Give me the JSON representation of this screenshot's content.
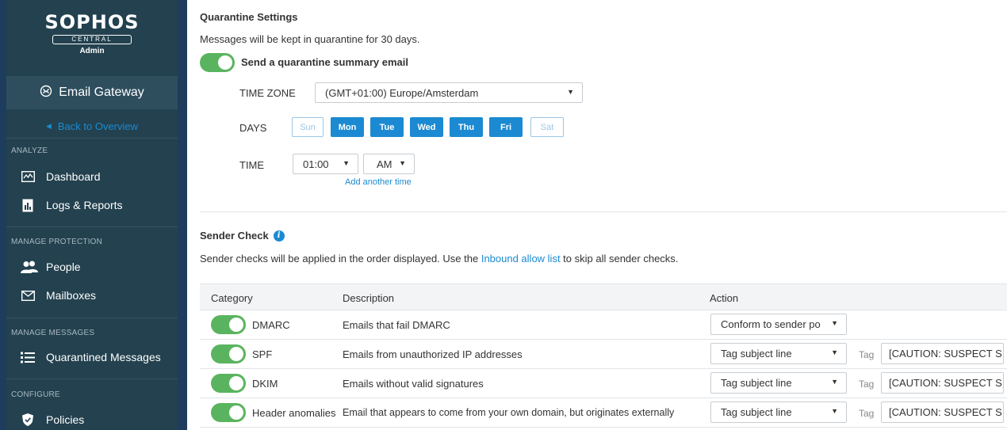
{
  "sidebar": {
    "logo": {
      "brand": "SOPHOS",
      "product": "CENTRAL",
      "role": "Admin"
    },
    "product_title": "Email Gateway",
    "back_label": "Back to Overview",
    "sections": [
      {
        "heading": "ANALYZE",
        "items": [
          {
            "label": "Dashboard",
            "icon": "dashboard-icon"
          },
          {
            "label": "Logs & Reports",
            "icon": "reports-icon"
          }
        ]
      },
      {
        "heading": "MANAGE PROTECTION",
        "items": [
          {
            "label": "People",
            "icon": "people-icon"
          },
          {
            "label": "Mailboxes",
            "icon": "mailbox-icon"
          }
        ]
      },
      {
        "heading": "MANAGE MESSAGES",
        "items": [
          {
            "label": "Quarantined Messages",
            "icon": "list-icon"
          }
        ]
      },
      {
        "heading": "CONFIGURE",
        "items": [
          {
            "label": "Policies",
            "icon": "shield-icon"
          }
        ]
      }
    ]
  },
  "quarantine": {
    "title": "Quarantine Settings",
    "description": "Messages will be kept in quarantine for 30 days.",
    "summary_toggle": {
      "label": "Send a quarantine summary email",
      "on": true
    },
    "time_zone": {
      "label": "TIME ZONE",
      "value": "(GMT+01:00) Europe/Amsterdam"
    },
    "days": {
      "label": "DAYS",
      "items": [
        {
          "label": "Sun",
          "selected": false
        },
        {
          "label": "Mon",
          "selected": true
        },
        {
          "label": "Tue",
          "selected": true
        },
        {
          "label": "Wed",
          "selected": true
        },
        {
          "label": "Thu",
          "selected": true
        },
        {
          "label": "Fri",
          "selected": true
        },
        {
          "label": "Sat",
          "selected": false
        }
      ]
    },
    "time": {
      "label": "TIME",
      "value": "01:00",
      "period": "AM",
      "add_label": "Add another time"
    }
  },
  "sender_check": {
    "title": "Sender Check",
    "description_pre": "Sender checks will be applied in the order displayed. Use the ",
    "description_link": "Inbound allow list",
    "description_post": " to skip all sender checks.",
    "columns": {
      "category": "Category",
      "description": "Description",
      "action": "Action"
    },
    "rows": [
      {
        "category": "DMARC",
        "description": "Emails that fail DMARC",
        "enabled": true,
        "action": "Conform to sender po",
        "tag_label": "",
        "tag_value": ""
      },
      {
        "category": "SPF",
        "description": "Emails from unauthorized IP addresses",
        "enabled": true,
        "action": "Tag subject line",
        "tag_label": "Tag",
        "tag_value": "[CAUTION: SUSPECT S"
      },
      {
        "category": "DKIM",
        "description": "Emails without valid signatures",
        "enabled": true,
        "action": "Tag subject line",
        "tag_label": "Tag",
        "tag_value": "[CAUTION: SUSPECT S"
      },
      {
        "category": "Header anomalies",
        "description": "Email that appears to come from your own domain, but originates externally",
        "enabled": true,
        "action": "Tag subject line",
        "tag_label": "Tag",
        "tag_value": "[CAUTION: SUSPECT S"
      }
    ]
  },
  "colors": {
    "accent": "#1b8ad2",
    "toggle_on": "#5ab45f",
    "sidebar": "#23414f"
  }
}
